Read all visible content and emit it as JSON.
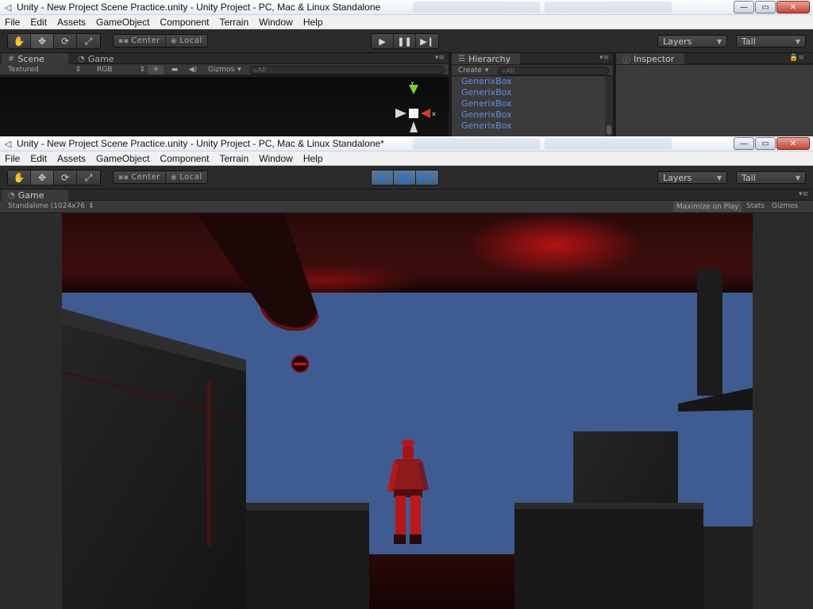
{
  "window1": {
    "title": "Unity - New Project Scene Practice.unity - Unity Project - PC, Mac & Linux Standalone",
    "window_buttons": {
      "minimize": "—",
      "maximize": "▭",
      "close": "✕"
    },
    "menu": [
      "File",
      "Edit",
      "Assets",
      "GameObject",
      "Component",
      "Terrain",
      "Window",
      "Help"
    ],
    "toolbar": {
      "transform_tools": [
        "hand-icon",
        "move-icon",
        "rotate-icon",
        "scale-icon"
      ],
      "pivot_mode": "Center",
      "pivot_rotation": "Local",
      "play_controls": [
        "play-icon",
        "pause-icon",
        "step-icon"
      ],
      "layers_label": "Layers",
      "layout_label": "Tall"
    },
    "tabs": {
      "scene": "Scene",
      "game": "Game",
      "hierarchy": "Hierarchy",
      "inspector": "Inspector"
    },
    "scene_controls": {
      "render_mode": "Textured",
      "color_mode": "RGB",
      "gizmos_label": "Gizmos",
      "search_placeholder": "All"
    },
    "gizmo_axes": {
      "y": "y",
      "x": "x"
    },
    "hierarchy": {
      "create_label": "Create",
      "search_placeholder": "All",
      "items": [
        "GenerixBox",
        "GenerixBox",
        "GenerixBox",
        "GenerixBox",
        "GenerixBox"
      ]
    }
  },
  "window2": {
    "title": "Unity - New Project Scene Practice.unity - Unity Project - PC, Mac & Linux Standalone*",
    "menu": [
      "File",
      "Edit",
      "Assets",
      "GameObject",
      "Component",
      "Terrain",
      "Window",
      "Help"
    ],
    "toolbar": {
      "pivot_mode": "Center",
      "pivot_rotation": "Local",
      "layers_label": "Layers",
      "layout_label": "Tall",
      "playing": true
    },
    "game_tab": "Game",
    "game_controls": {
      "resolution": "Standalone (1024x76",
      "maximize_on_play": "Maximize on Play",
      "stats": "Stats",
      "gizmos": "Gizmos"
    }
  },
  "colors": {
    "editor_dark": "#2b2b2b",
    "sky_blue": "#3e5c91",
    "hierarchy_link": "#5e8fe6",
    "play_active": "#1d78d8",
    "scene_red": "#b31212"
  }
}
